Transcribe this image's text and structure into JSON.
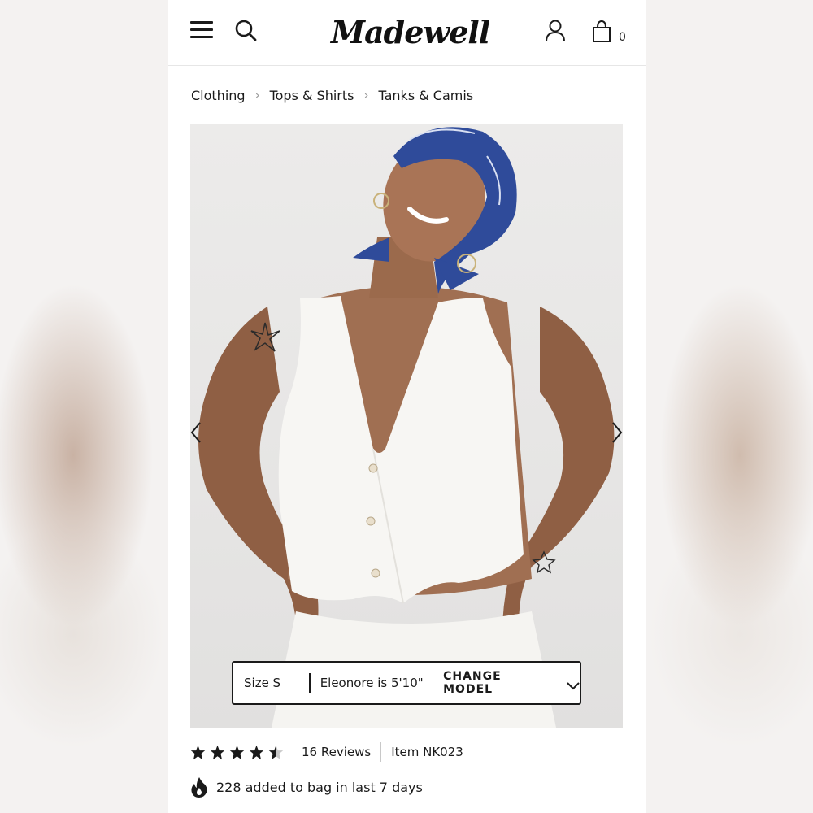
{
  "header": {
    "logo_text": "Madewell",
    "bag_count": "0",
    "icons": [
      "menu-icon",
      "search-icon",
      "account-icon",
      "bag-icon"
    ]
  },
  "breadcrumb": {
    "items": [
      {
        "label": "Clothing"
      },
      {
        "label": "Tops & Shirts"
      },
      {
        "label": "Tanks & Camis"
      }
    ]
  },
  "product_image": {
    "alt_subject": "model-in-white-vest-photo",
    "model_bar": {
      "size_label": "Size S",
      "model_text": "Eleonore is 5'10\"",
      "change_model_label": "CHANGE MODEL"
    }
  },
  "rating": {
    "value": 4.5,
    "max": 5,
    "reviews_label": "16 Reviews",
    "item_label": "Item NK023"
  },
  "social_proof": {
    "text": "228 added to bag in last 7 days"
  },
  "colors": {
    "text": "#1a1a1a",
    "scarf_blue": "#2f4b9a",
    "skin": "#9b6a4c"
  }
}
